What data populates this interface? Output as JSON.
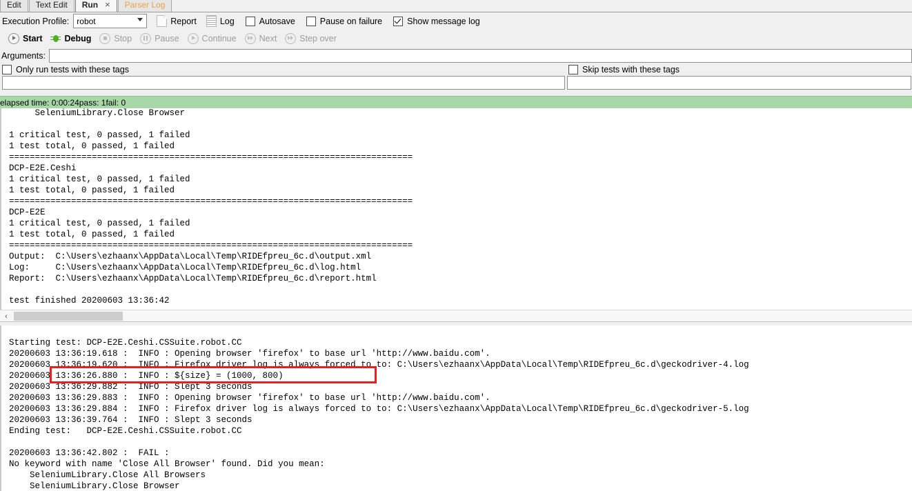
{
  "tabs": [
    {
      "label": "Edit",
      "state": "normal"
    },
    {
      "label": "Text Edit",
      "state": "normal"
    },
    {
      "label": "Run",
      "state": "active",
      "close": "×"
    },
    {
      "label": "Parser Log",
      "state": "dim"
    }
  ],
  "toolbar": {
    "execution_profile_label": "Execution Profile:",
    "profile_value": "robot",
    "report_label": "Report",
    "log_label": "Log",
    "autosave_label": "Autosave",
    "autosave_checked": false,
    "pause_on_failure_label": "Pause on failure",
    "pause_on_failure_checked": false,
    "show_message_log_label": "Show message log",
    "show_message_log_checked": true
  },
  "runbar": {
    "start_label": "Start",
    "debug_label": "Debug",
    "stop_label": "Stop",
    "pause_label": "Pause",
    "continue_label": "Continue",
    "next_label": "Next",
    "step_over_label": "Step over"
  },
  "arguments": {
    "label": "Arguments:",
    "value": "",
    "placeholder": ""
  },
  "tags": {
    "include_label": "Only run tests with these tags",
    "include_checked": true,
    "include_value": "",
    "exclude_label": "Skip tests with these tags",
    "exclude_checked": false,
    "exclude_value": ""
  },
  "status": {
    "elapsed": "elapsed time: 0:00:24",
    "pass": "pass: 1",
    "fail": "fail: 0"
  },
  "output_panel": {
    "text": "     SeleniumLibrary.Close Browser\n\n1 critical test, 0 passed, 1 failed\n1 test total, 0 passed, 1 failed\n==============================================================================\nDCP-E2E.Ceshi\n1 critical test, 0 passed, 1 failed\n1 test total, 0 passed, 1 failed\n==============================================================================\nDCP-E2E\n1 critical test, 0 passed, 1 failed\n1 test total, 0 passed, 1 failed\n==============================================================================\nOutput:  C:\\Users\\ezhaanx\\AppData\\Local\\Temp\\RIDEfpreu_6c.d\\output.xml\nLog:     C:\\Users\\ezhaanx\\AppData\\Local\\Temp\\RIDEfpreu_6c.d\\log.html\nReport:  C:\\Users\\ezhaanx\\AppData\\Local\\Temp\\RIDEfpreu_6c.d\\report.html\n\ntest finished 20200603 13:36:42"
  },
  "message_log": {
    "text": "Starting test: DCP-E2E.Ceshi.CSSuite.robot.CC\n20200603 13:36:19.618 :  INFO : Opening browser 'firefox' to base url 'http://www.baidu.com'.\n20200603 13:36:19.620 :  INFO : Firefox driver log is always forced to to: C:\\Users\\ezhaanx\\AppData\\Local\\Temp\\RIDEfpreu_6c.d\\geckodriver-4.log\n20200603 13:36:26.880 :  INFO : ${size} = (1000, 800)\n20200603 13:36:29.882 :  INFO : Slept 3 seconds\n20200603 13:36:29.883 :  INFO : Opening browser 'firefox' to base url 'http://www.baidu.com'.\n20200603 13:36:29.884 :  INFO : Firefox driver log is always forced to to: C:\\Users\\ezhaanx\\AppData\\Local\\Temp\\RIDEfpreu_6c.d\\geckodriver-5.log\n20200603 13:36:39.764 :  INFO : Slept 3 seconds\nEnding test:   DCP-E2E.Ceshi.CSSuite.robot.CC\n\n20200603 13:36:42.802 :  FAIL :\nNo keyword with name 'Close All Browser' found. Did you mean:\n    SeleniumLibrary.Close All Browsers\n    SeleniumLibrary.Close Browser"
  },
  "scrollbar": {
    "left_arrow": "‹"
  },
  "colors": {
    "status_green": "#a8d8a8",
    "highlight_red": "#ee1c1c",
    "dim_tab": "#e8a33d",
    "debug_green": "#4caf20"
  }
}
